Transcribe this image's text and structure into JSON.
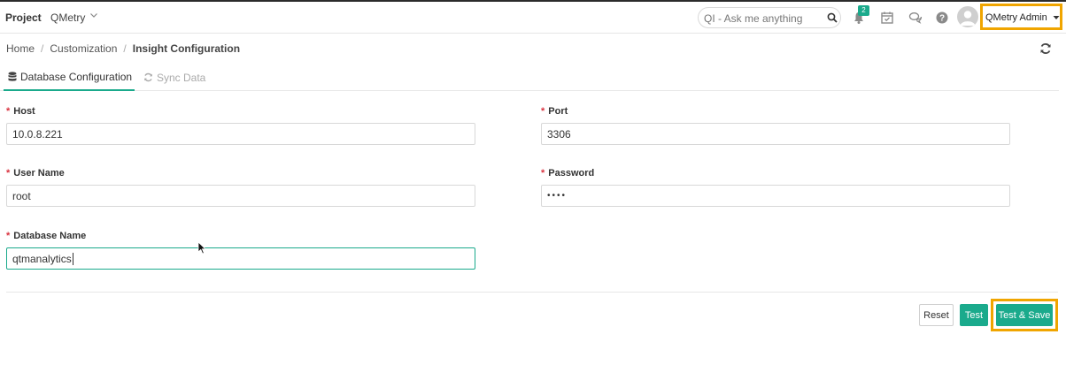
{
  "header": {
    "project_label": "Project",
    "project_name": "QMetry",
    "search_placeholder": "QI - Ask me anything",
    "notification_count": "2",
    "user_name": "QMetry Admin",
    "icons": [
      "chevron-down-icon",
      "search-icon",
      "bell-icon",
      "calendar-check-icon",
      "chat-icon",
      "help-icon",
      "avatar-icon",
      "caret-down-icon"
    ]
  },
  "breadcrumb": {
    "items": [
      "Home",
      "Customization"
    ],
    "current": "Insight Configuration"
  },
  "tabs": [
    {
      "label": "Database Configuration",
      "icon": "database-icon",
      "active": true
    },
    {
      "label": "Sync Data",
      "icon": "sync-icon",
      "active": false
    }
  ],
  "form": {
    "host": {
      "label": "Host",
      "value": "10.0.8.221"
    },
    "port": {
      "label": "Port",
      "value": "3306"
    },
    "username": {
      "label": "User Name",
      "value": "root"
    },
    "password": {
      "label": "Password",
      "value": "••••"
    },
    "database": {
      "label": "Database Name",
      "value": "qtmanalytics"
    },
    "required_marker": "*"
  },
  "actions": {
    "reset": "Reset",
    "test": "Test",
    "test_save": "Test & Save"
  },
  "colors": {
    "accent": "#1aaa8c",
    "highlight": "#f0a500",
    "required": "#d9323f"
  }
}
